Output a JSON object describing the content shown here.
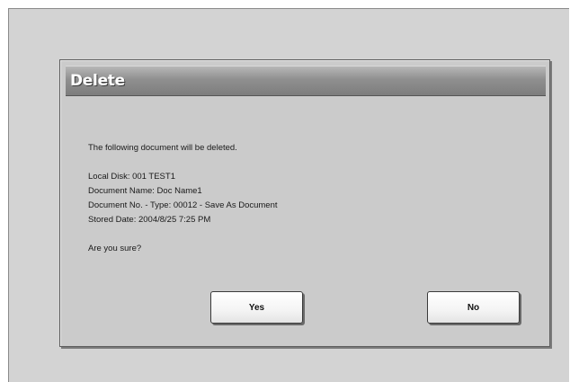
{
  "dialog": {
    "title": "Delete",
    "intro": "The following document will be deleted.",
    "details": {
      "location": "Local Disk: 001 TEST1",
      "document_name": "Document Name: Doc Name1",
      "document_no_type": "Document No. - Type: 00012 - Save As Document",
      "stored_date": "Stored Date: 2004/8/25 7:25 PM"
    },
    "question": "Are you sure?",
    "yes_label": "Yes",
    "no_label": "No"
  }
}
